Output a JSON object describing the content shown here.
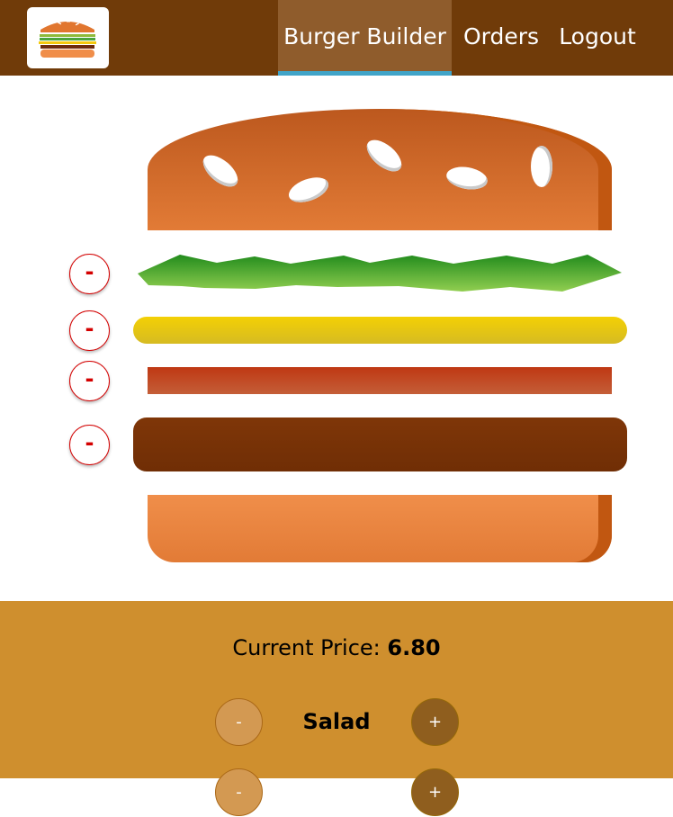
{
  "nav": {
    "logo_icon": "burger-logo",
    "items": [
      {
        "label": "Burger Builder",
        "active": true
      },
      {
        "label": "Orders",
        "active": false
      },
      {
        "label": "Logout",
        "active": false
      }
    ]
  },
  "burger": {
    "remove_label": "-",
    "layers": [
      "bread-top",
      "salad",
      "cheese",
      "bacon",
      "meat",
      "bread-bottom"
    ]
  },
  "controls": {
    "price_label": "Current Price:",
    "price_value": "6.80",
    "rows": [
      {
        "label": "Salad",
        "less": "-",
        "more": "+"
      },
      {
        "label": "",
        "less": "-",
        "more": "+"
      }
    ]
  },
  "colors": {
    "toolbar": "#703b09",
    "active_tab": "#8f5c2c",
    "active_underline": "#40a4c8",
    "controls_bg": "#cf8f2e"
  }
}
